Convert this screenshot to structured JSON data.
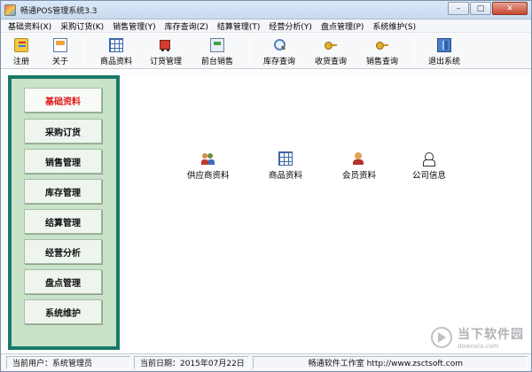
{
  "window": {
    "title": "畅通POS管理系统3.3",
    "controls": {
      "minimize": "–",
      "maximize": "□",
      "close": "✕"
    }
  },
  "menubar": [
    {
      "label": "基础资料(X)"
    },
    {
      "label": "采购订货(K)"
    },
    {
      "label": "销售管理(Y)"
    },
    {
      "label": "库存查询(Z)"
    },
    {
      "label": "结算管理(T)"
    },
    {
      "label": "经营分析(Y)"
    },
    {
      "label": "盘点管理(P)"
    },
    {
      "label": "系统维护(S)"
    }
  ],
  "toolbar": {
    "buttons": [
      {
        "label": "注册",
        "icon": "register-icon"
      },
      {
        "label": "关于",
        "icon": "about-icon"
      },
      {
        "label": "商品资料",
        "icon": "product-grid-icon"
      },
      {
        "label": "订货管理",
        "icon": "truck-icon"
      },
      {
        "label": "前台销售",
        "icon": "pos-terminal-icon"
      },
      {
        "label": "库存查询",
        "icon": "search-icon"
      },
      {
        "label": "收货查询",
        "icon": "key-icon"
      },
      {
        "label": "销售查询",
        "icon": "key-icon"
      },
      {
        "label": "退出系统",
        "icon": "exit-icon"
      }
    ]
  },
  "leftnav": {
    "accent_color": "#1a7a6a",
    "active_color": "#e21a1a",
    "items": [
      {
        "label": "基础资料",
        "active": true
      },
      {
        "label": "采购订货"
      },
      {
        "label": "销售管理"
      },
      {
        "label": "库存管理"
      },
      {
        "label": "结算管理"
      },
      {
        "label": "经营分析"
      },
      {
        "label": "盘点管理"
      },
      {
        "label": "系统维护"
      }
    ]
  },
  "main": {
    "modules": [
      {
        "label": "供应商资料",
        "icon": "people-icon"
      },
      {
        "label": "商品资料",
        "icon": "product-grid-icon"
      },
      {
        "label": "会员资料",
        "icon": "member-icon"
      },
      {
        "label": "公司信息",
        "icon": "company-icon"
      }
    ]
  },
  "statusbar": {
    "user": "当前用户：系统管理员",
    "date": "当前日期：2015年07月22日",
    "vendor": "畅通软件工作室 http://www.zsctsoft.com"
  },
  "watermark": {
    "text": "当下软件园",
    "url": "downxia.com"
  }
}
